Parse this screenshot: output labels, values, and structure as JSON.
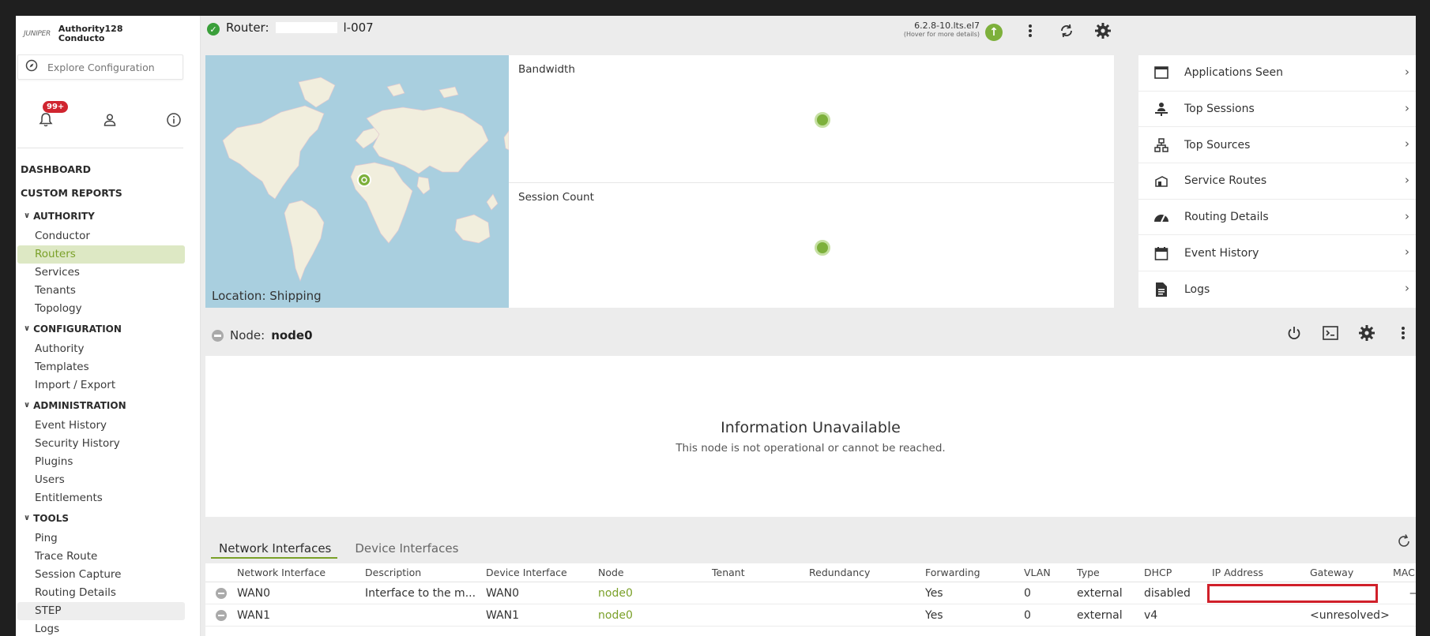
{
  "brand": {
    "logo": "JUNIPER",
    "line1": "Authority128",
    "line2": "Conducto"
  },
  "search": {
    "placeholder": "Explore Configuration"
  },
  "notifications": {
    "badge": "99+"
  },
  "nav": {
    "dashboard": "DASHBOARD",
    "custom_reports": "CUSTOM REPORTS",
    "groups": [
      {
        "label": "AUTHORITY",
        "items": [
          "Conductor",
          "Routers",
          "Services",
          "Tenants",
          "Topology"
        ]
      },
      {
        "label": "CONFIGURATION",
        "items": [
          "Authority",
          "Templates",
          "Import / Export"
        ]
      },
      {
        "label": "ADMINISTRATION",
        "items": [
          "Event History",
          "Security History",
          "Plugins",
          "Users",
          "Entitlements"
        ]
      },
      {
        "label": "TOOLS",
        "items": [
          "Ping",
          "Trace Route",
          "Session Capture",
          "Routing Details",
          "STEP",
          "Logs"
        ]
      }
    ],
    "active_item": "Routers",
    "hover_item": "STEP"
  },
  "header": {
    "router_prefix": "Router:",
    "router_suffix": "l-007",
    "version": "6.2.8-10.lts.el7",
    "version_hint": "(Hover for more details)"
  },
  "map": {
    "location": "Location: Shipping"
  },
  "charts": {
    "bandwidth": "Bandwidth",
    "session_count": "Session Count"
  },
  "panel": {
    "items": [
      {
        "label": "Applications Seen",
        "icon": "window-icon"
      },
      {
        "label": "Top Sessions",
        "icon": "person-desk-icon"
      },
      {
        "label": "Top Sources",
        "icon": "network-tree-icon"
      },
      {
        "label": "Service Routes",
        "icon": "route-icon"
      },
      {
        "label": "Routing Details",
        "icon": "gauge-icon"
      },
      {
        "label": "Event History",
        "icon": "calendar-icon"
      },
      {
        "label": "Logs",
        "icon": "document-icon"
      }
    ]
  },
  "node": {
    "prefix": "Node:",
    "name": "node0"
  },
  "info": {
    "title": "Information Unavailable",
    "message": "This node is not operational or cannot be reached."
  },
  "tabs": {
    "network": "Network Interfaces",
    "device": "Device Interfaces"
  },
  "table": {
    "columns": [
      "Network Interface",
      "Description",
      "Device Interface",
      "Node",
      "Tenant",
      "Redundancy",
      "Forwarding",
      "VLAN",
      "Type",
      "DHCP",
      "IP Address",
      "Gateway",
      "MAC"
    ],
    "rows": [
      {
        "network_interface": "WAN0",
        "description": "Interface to the m...",
        "device_interface": "WAN0",
        "node": "node0",
        "tenant": "",
        "redundancy": "",
        "forwarding": "Yes",
        "vlan": "0",
        "type": "external",
        "dhcp": "disabled",
        "ip": "",
        "gateway": "",
        "mac": "—"
      },
      {
        "network_interface": "WAN1",
        "description": "",
        "device_interface": "WAN1",
        "node": "node0",
        "tenant": "",
        "redundancy": "",
        "forwarding": "Yes",
        "vlan": "0",
        "type": "external",
        "dhcp": "v4",
        "ip": "",
        "gateway": "<unresolved>",
        "mac": ""
      }
    ]
  },
  "colors": {
    "accent": "#7aa028",
    "status_ok": "#3a9f3a",
    "highlight_box": "#d0202a"
  }
}
